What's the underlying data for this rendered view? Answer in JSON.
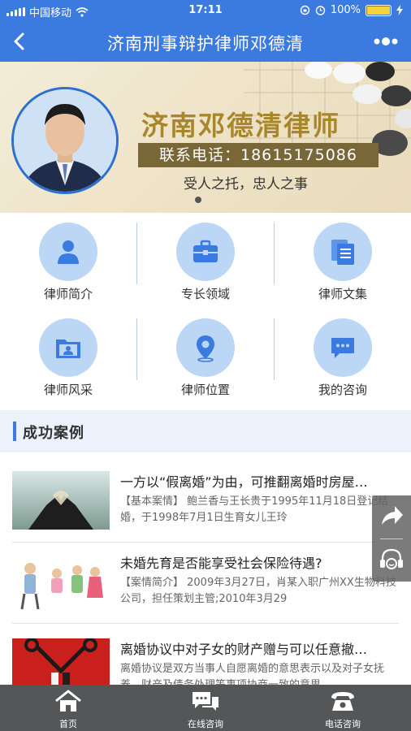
{
  "status_bar": {
    "carrier": "中国移动",
    "time": "17:11",
    "battery": "100%"
  },
  "nav": {
    "title": "济南刑事辩护律师邓德清"
  },
  "banner": {
    "headline": "济南邓德清律师",
    "phone": "联系电话：18615175086",
    "slogan": "受人之托，忠人之事"
  },
  "grid": [
    {
      "label": "律师简介",
      "icon": "person-icon"
    },
    {
      "label": "专长领域",
      "icon": "briefcase-icon"
    },
    {
      "label": "律师文集",
      "icon": "documents-icon"
    },
    {
      "label": "律师风采",
      "icon": "folder-person-icon"
    },
    {
      "label": "律师位置",
      "icon": "location-pin-icon"
    },
    {
      "label": "我的咨询",
      "icon": "chat-bubble-icon"
    }
  ],
  "section": {
    "title": "成功案例"
  },
  "cases": [
    {
      "title": "一方以“假离婚”为由，可推翻离婚时房屋…",
      "desc": "【基本案情】 鲍兰香与王长贵于1995年11月18日登记结婚，于1998年7月1日生育女儿王玲"
    },
    {
      "title": "未婚先育是否能享受社会保险待遇?",
      "desc": "【案情简介】 2009年3月27日，肖某入职广州XX生物科技公司，担任策划主管;2010年3月29"
    },
    {
      "title": "离婚协议中对子女的财产赠与可以任意撤…",
      "desc": "离婚协议是双方当事人自愿离婚的意思表示以及对子女抚养、财产及债务处理等事项协商一致的意思"
    }
  ],
  "tabbar": [
    {
      "label": "首页",
      "icon": "home-icon"
    },
    {
      "label": "在线咨询",
      "icon": "chat-icon"
    },
    {
      "label": "电话咨询",
      "icon": "phone-icon"
    }
  ],
  "colors": {
    "primary": "#3b7be0",
    "icon_circle": "#bcd6f6",
    "tabbar": "#555657",
    "banner_gold": "#a8872c"
  }
}
